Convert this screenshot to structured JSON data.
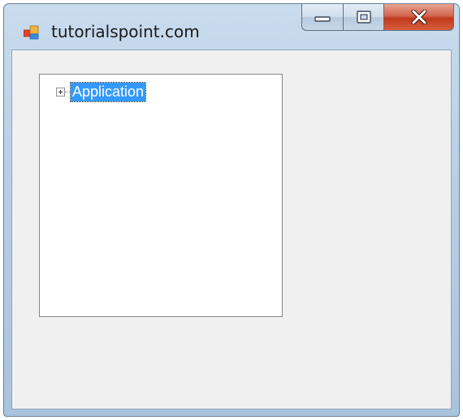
{
  "window": {
    "title": "tutorialspoint.com",
    "icon": "winforms-app-icon",
    "controls": {
      "minimize": "minimize-icon",
      "maximize": "maximize-icon",
      "close": "close-icon"
    }
  },
  "treeview": {
    "nodes": [
      {
        "label": "Application",
        "expanded": false,
        "selected": true
      }
    ]
  },
  "colors": {
    "selection": "#3399ff",
    "close_button": "#c0391c",
    "client_background": "#f0f0f0"
  }
}
